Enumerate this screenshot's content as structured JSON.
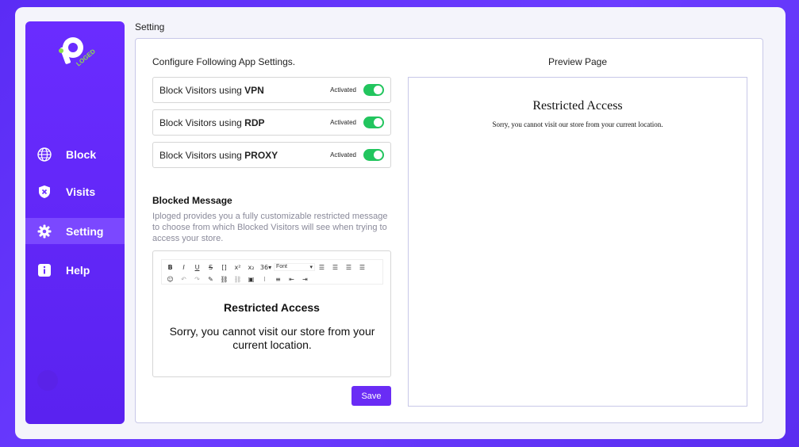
{
  "app": {
    "logo_text": "LOGED",
    "accent": "#6a2cf5",
    "toggle_color": "#22c55e"
  },
  "sidebar": {
    "items": [
      {
        "label": "Block",
        "icon": "globe-icon"
      },
      {
        "label": "Visits",
        "icon": "shield-x-icon"
      },
      {
        "label": "Setting",
        "icon": "gear-icon",
        "active": true
      },
      {
        "label": "Help",
        "icon": "info-icon"
      }
    ]
  },
  "breadcrumb": "Setting",
  "config": {
    "title": "Configure Following App Settings.",
    "rows": [
      {
        "prefix": "Block Visitors using ",
        "bold": "VPN",
        "status": "Activated"
      },
      {
        "prefix": "Block Visitors using ",
        "bold": "RDP",
        "status": "Activated"
      },
      {
        "prefix": "Block Visitors using ",
        "bold": "PROXY",
        "status": "Activated"
      }
    ]
  },
  "blocked_message": {
    "title": "Blocked Message",
    "description": "Iploged provides you a fully customizable restricted message  to choose from which Blocked Visitors will see when trying to access your store."
  },
  "editor": {
    "toolbar": {
      "font_size": "36",
      "font_label": "Font"
    },
    "heading": "Restricted Access",
    "message": "Sorry, you cannot visit our store from your current location."
  },
  "save_label": "Save",
  "preview": {
    "title": "Preview Page",
    "heading": "Restricted Access",
    "message": "Sorry, you cannot visit our store from your current location."
  }
}
